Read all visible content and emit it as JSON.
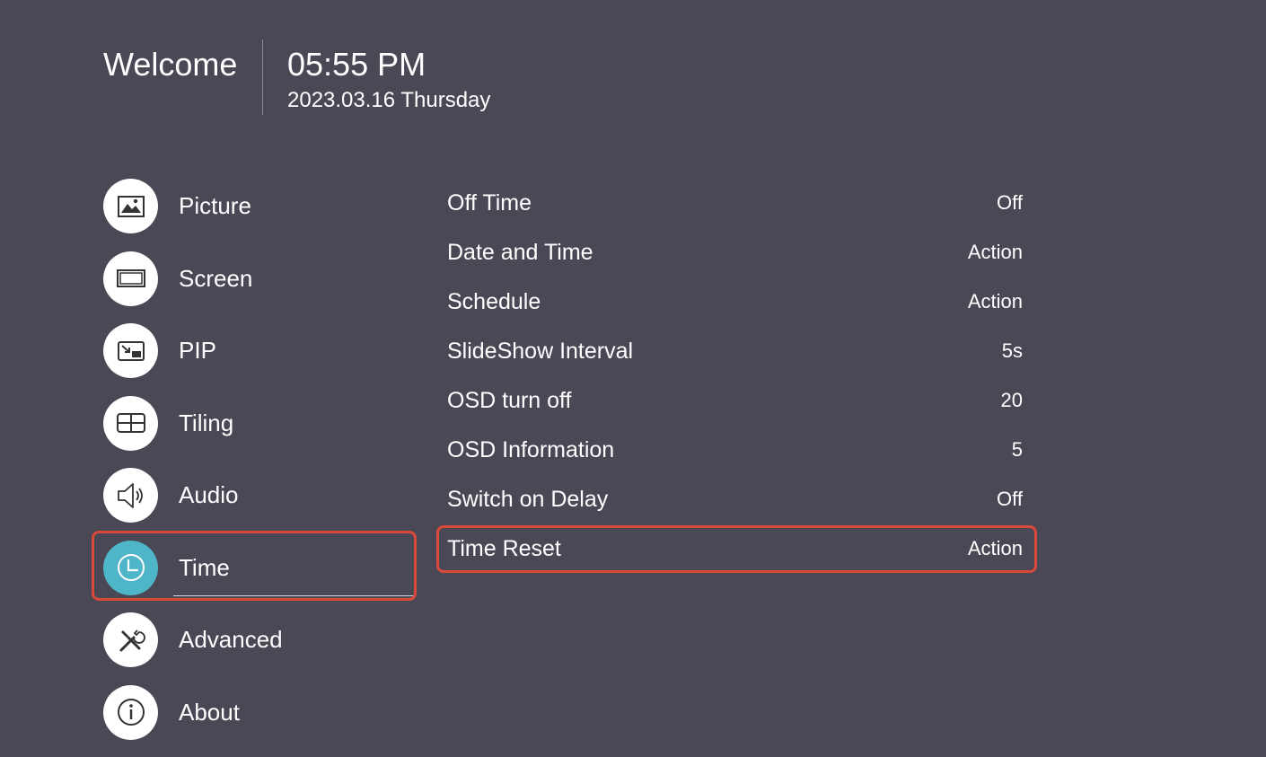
{
  "header": {
    "welcome": "Welcome",
    "time": "05:55 PM",
    "date": "2023.03.16 Thursday"
  },
  "menu": {
    "items": [
      {
        "label": "Picture",
        "icon": "picture-icon"
      },
      {
        "label": "Screen",
        "icon": "screen-icon"
      },
      {
        "label": "PIP",
        "icon": "pip-icon"
      },
      {
        "label": "Tiling",
        "icon": "tiling-icon"
      },
      {
        "label": "Audio",
        "icon": "speaker-icon"
      },
      {
        "label": "Time",
        "icon": "clock-icon",
        "active": true
      },
      {
        "label": "Advanced",
        "icon": "tools-icon"
      },
      {
        "label": "About",
        "icon": "info-icon"
      }
    ]
  },
  "settings": {
    "rows": [
      {
        "label": "Off Time",
        "value": "Off"
      },
      {
        "label": "Date and Time",
        "value": "Action"
      },
      {
        "label": "Schedule",
        "value": "Action"
      },
      {
        "label": "SlideShow Interval",
        "value": "5s"
      },
      {
        "label": "OSD turn off",
        "value": "20"
      },
      {
        "label": "OSD Information",
        "value": "5"
      },
      {
        "label": "Switch on Delay",
        "value": "Off"
      },
      {
        "label": "Time Reset",
        "value": "Action",
        "selected": true
      }
    ]
  },
  "colors": {
    "background": "#4a4854",
    "accent": "#4fb6c9",
    "highlight": "#d9493b"
  }
}
